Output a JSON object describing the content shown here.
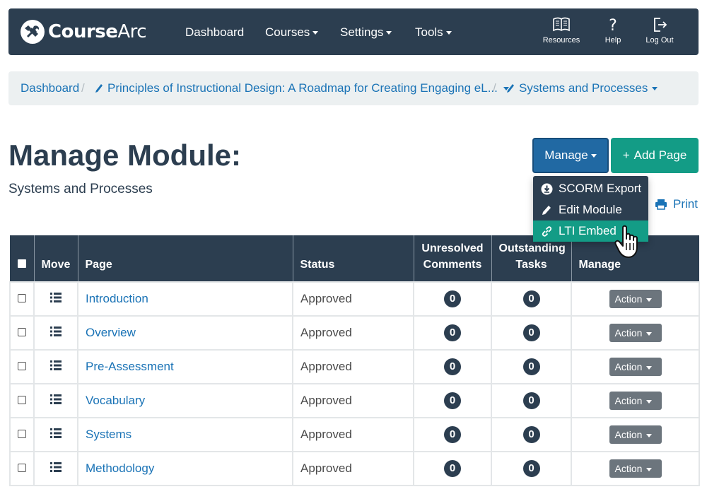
{
  "brand": {
    "name_bold": "Course",
    "name_light": "Arc"
  },
  "nav": {
    "dashboard": "Dashboard",
    "courses": "Courses",
    "settings": "Settings",
    "tools": "Tools",
    "resources": "Resources",
    "help": "Help",
    "logout": "Log Out"
  },
  "breadcrumb": {
    "home": "Dashboard",
    "course": "Principles of Instructional Design: A Roadmap for Creating Engaging eL...",
    "module": "Systems and Processes",
    "separator": "/"
  },
  "header": {
    "title": "Manage Module:",
    "subtitle": "Systems and Processes",
    "manage_label": "Manage",
    "add_page_label": "Add Page",
    "add_page_prefix": "+",
    "print_label": "Print"
  },
  "manage_menu": {
    "items": [
      {
        "label": "SCORM Export",
        "icon": "download-circle-icon"
      },
      {
        "label": "Edit Module",
        "icon": "pencil-icon"
      },
      {
        "label": "LTI Embed",
        "icon": "link-icon",
        "active": true
      }
    ]
  },
  "table": {
    "headers": {
      "move": "Move",
      "page": "Page",
      "status": "Status",
      "unresolved_1": "Unresolved",
      "unresolved_2": "Comments",
      "outstanding_1": "Outstanding",
      "outstanding_2": "Tasks",
      "manage": "Manage"
    },
    "action_label": "Action",
    "rows": [
      {
        "page": "Introduction",
        "status": "Approved",
        "comments": "0",
        "tasks": "0"
      },
      {
        "page": "Overview",
        "status": "Approved",
        "comments": "0",
        "tasks": "0"
      },
      {
        "page": "Pre-Assessment",
        "status": "Approved",
        "comments": "0",
        "tasks": "0"
      },
      {
        "page": "Vocabulary",
        "status": "Approved",
        "comments": "0",
        "tasks": "0"
      },
      {
        "page": "Systems",
        "status": "Approved",
        "comments": "0",
        "tasks": "0"
      },
      {
        "page": "Methodology",
        "status": "Approved",
        "comments": "0",
        "tasks": "0"
      }
    ]
  },
  "colors": {
    "navbar": "#2c3e50",
    "link": "#1a73b6",
    "manage_button": "#2169a3",
    "add_button": "#139c86",
    "active_menu": "#139c86",
    "action_button": "#6c757d"
  }
}
